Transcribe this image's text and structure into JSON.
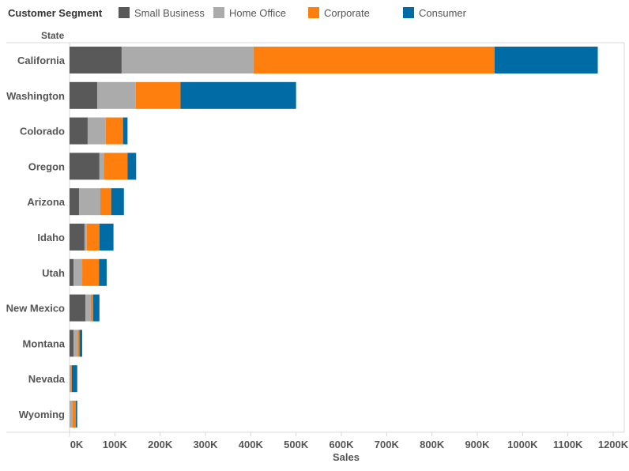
{
  "legend": {
    "title": "Customer Segment",
    "items": [
      {
        "label": "Small Business",
        "color": "#595959"
      },
      {
        "label": "Home Office",
        "color": "#ababab"
      },
      {
        "label": "Corporate",
        "color": "#ff7f0e"
      },
      {
        "label": "Consumer",
        "color": "#006ba4"
      }
    ]
  },
  "row_header": "State",
  "chart_data": {
    "type": "bar",
    "orientation": "horizontal",
    "stacked": true,
    "title": "",
    "xlabel": "Sales",
    "ylabel": "State",
    "xlim": [
      0,
      1200000
    ],
    "x_ticks": [
      "0K",
      "100K",
      "200K",
      "300K",
      "400K",
      "500K",
      "600K",
      "700K",
      "800K",
      "900K",
      "1000K",
      "1100K",
      "1200K"
    ],
    "x_tick_values": [
      0,
      100000,
      200000,
      300000,
      400000,
      500000,
      600000,
      700000,
      800000,
      900000,
      1000000,
      1100000,
      1200000
    ],
    "legend_position": "top",
    "grid": false,
    "categories": [
      "California",
      "Washington",
      "Colorado",
      "Oregon",
      "Arizona",
      "Idaho",
      "Utah",
      "New Mexico",
      "Montana",
      "Nevada",
      "Wyoming"
    ],
    "series": [
      {
        "name": "Small Business",
        "color": "#595959",
        "values": [
          115000,
          61000,
          40000,
          66000,
          21000,
          33000,
          9000,
          35000,
          9000,
          0,
          0
        ]
      },
      {
        "name": "Home Office",
        "color": "#ababab",
        "values": [
          291000,
          85000,
          40000,
          10000,
          47000,
          5000,
          19000,
          12000,
          9000,
          2000,
          7000
        ]
      },
      {
        "name": "Corporate",
        "color": "#ff7f0e",
        "values": [
          532000,
          99000,
          38000,
          52000,
          24000,
          28000,
          37000,
          5000,
          4000,
          3000,
          7000
        ]
      },
      {
        "name": "Consumer",
        "color": "#006ba4",
        "values": [
          228000,
          255000,
          10000,
          19000,
          28000,
          31000,
          17000,
          14000,
          6000,
          12000,
          3000
        ]
      }
    ]
  }
}
